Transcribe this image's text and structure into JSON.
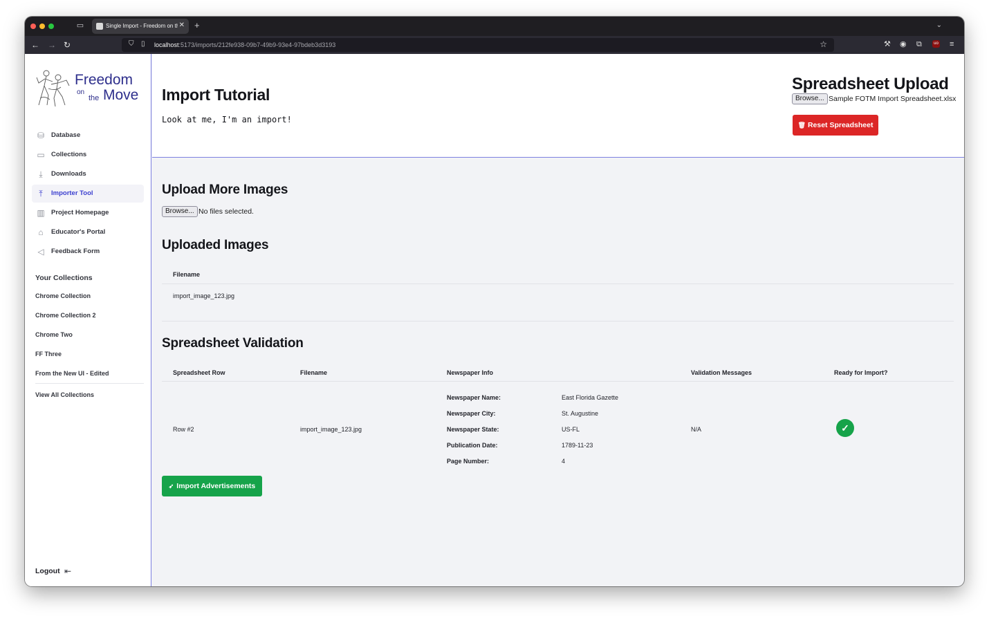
{
  "browser": {
    "tab_title": "Single Import - Freedom on the",
    "url_host": "localhost",
    "url_path": ":5173/imports/212fe938-09b7-49b9-93e4-97bdeb3d3193"
  },
  "logo": {
    "line1": "Freedom",
    "on": "on",
    "the": "the",
    "line2": "Move"
  },
  "sidebar": {
    "items": [
      {
        "label": "Database",
        "icon": "database-icon"
      },
      {
        "label": "Collections",
        "icon": "folder-icon"
      },
      {
        "label": "Downloads",
        "icon": "download-icon"
      },
      {
        "label": "Importer Tool",
        "icon": "upload-icon",
        "active": true
      },
      {
        "label": "Project Homepage",
        "icon": "building-icon"
      },
      {
        "label": "Educator's Portal",
        "icon": "graduation-cap-icon"
      },
      {
        "label": "Feedback Form",
        "icon": "megaphone-icon"
      }
    ],
    "collections_heading": "Your Collections",
    "collections": [
      "Chrome Collection",
      "Chrome Collection 2",
      "Chrome Two",
      "FF Three",
      "From the New UI - Edited"
    ],
    "view_all": "View All Collections",
    "logout": "Logout"
  },
  "header": {
    "title": "Import Tutorial",
    "description": "Look at me, I'm an import!",
    "spreadsheet_title": "Spreadsheet Upload",
    "browse_label": "Browse...",
    "spreadsheet_file": "Sample FOTM Import Spreadsheet.xlsx",
    "reset_label": "Reset Spreadsheet"
  },
  "upload": {
    "title": "Upload More Images",
    "browse_label": "Browse...",
    "status": "No files selected."
  },
  "uploaded": {
    "title": "Uploaded Images",
    "column": "Filename",
    "files": [
      "import_image_123.jpg"
    ]
  },
  "validation": {
    "title": "Spreadsheet Validation",
    "columns": [
      "Spreadsheet Row",
      "Filename",
      "Newspaper Info",
      "Validation Messages",
      "Ready for Import?"
    ],
    "rows": [
      {
        "row": "Row #2",
        "filename": "import_image_123.jpg",
        "info": [
          {
            "label": "Newspaper Name:",
            "value": "East Florida Gazette"
          },
          {
            "label": "Newspaper City:",
            "value": "St. Augustine"
          },
          {
            "label": "Newspaper State:",
            "value": "US-FL"
          },
          {
            "label": "Publication Date:",
            "value": "1789-11-23"
          },
          {
            "label": "Page Number:",
            "value": "4"
          }
        ],
        "messages": "N/A",
        "ready": true
      }
    ],
    "import_label": "Import Advertisements"
  },
  "colors": {
    "accent": "#3b3fcf",
    "danger": "#dc2626",
    "success": "#16a34a",
    "divider": "#7c7fe0"
  }
}
